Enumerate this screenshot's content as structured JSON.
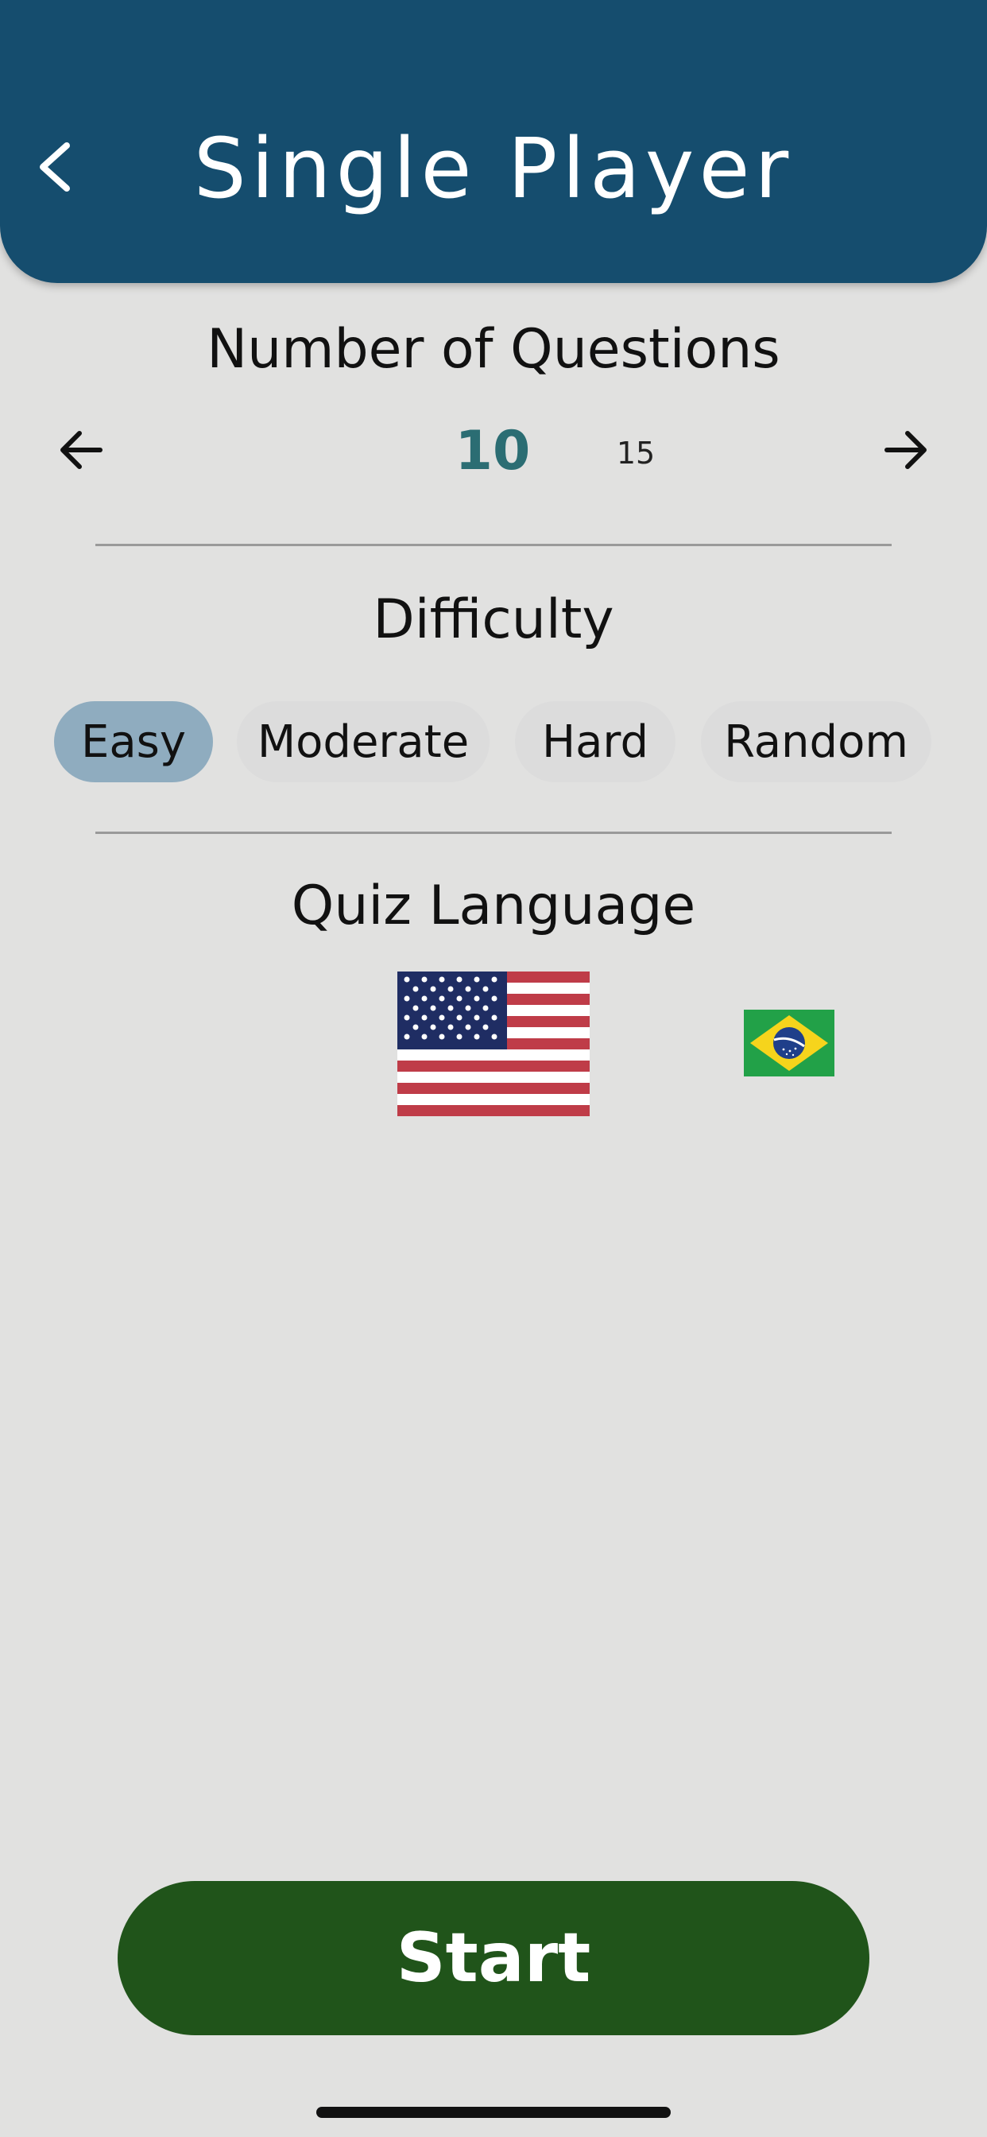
{
  "header": {
    "title": "Single Player",
    "back_icon": "chevron-left-icon"
  },
  "questions": {
    "title": "Number of Questions",
    "selected": "10",
    "next_option": "15",
    "prev_icon": "arrow-left-icon",
    "next_icon": "arrow-right-icon"
  },
  "difficulty": {
    "title": "Difficulty",
    "options": [
      "Easy",
      "Moderate",
      "Hard",
      "Random"
    ],
    "selected": "Easy"
  },
  "language": {
    "title": "Quiz Language",
    "flags": [
      "us-flag-icon",
      "brazil-flag-icon"
    ],
    "selected": "us-flag-icon"
  },
  "start_button": "Start",
  "colors": {
    "header_bg": "#154d6e",
    "page_bg": "#e1e1e0",
    "selected_number": "#2b6d73",
    "selected_chip": "#8facbf",
    "start_button": "#20541a"
  }
}
